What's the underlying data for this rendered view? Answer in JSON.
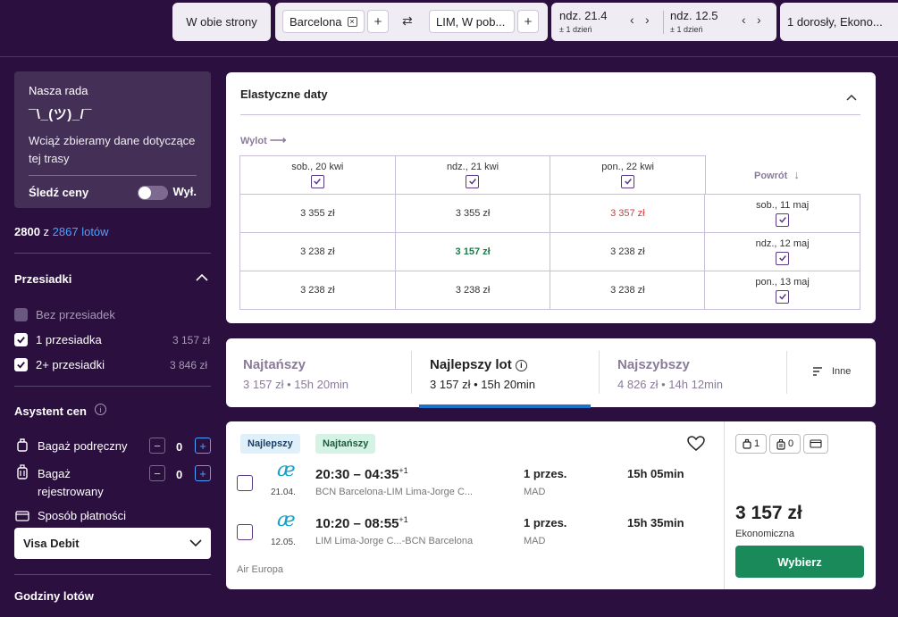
{
  "search": {
    "trip_type": "W obie strony",
    "origin": "Barcelona",
    "destination": "LIM, W pob...",
    "depart": {
      "date": "ndz. 21.4",
      "flex": "± 1 dzień"
    },
    "return": {
      "date": "ndz. 12.5",
      "flex": "± 1 dzień"
    },
    "passengers": "1 dorosły, Ekono..."
  },
  "advice": {
    "title": "Nasza rada",
    "shrug": "¯\\_(ツ)_/¯",
    "text": "Wciąż zbieramy dane dotyczące tej trasy",
    "track_label": "Śledź ceny",
    "toggle_state": "Wył."
  },
  "results_count": {
    "shown": "2800",
    "of": "z",
    "total": "2867 lotów"
  },
  "stops": {
    "title": "Przesiadki",
    "options": [
      {
        "label": "Bez przesiadek",
        "price": "",
        "checked": false,
        "disabled": true
      },
      {
        "label": "1 przesiadka",
        "price": "3 157 zł",
        "checked": true,
        "disabled": false
      },
      {
        "label": "2+ przesiadki",
        "price": "3 846 zł",
        "checked": true,
        "disabled": false
      }
    ]
  },
  "price_assistant": {
    "title": "Asystent cen",
    "carry_on": {
      "label": "Bagaż podręczny",
      "count": "0"
    },
    "checked_bag": {
      "label": "Bagaż rejestrowany",
      "count": "0"
    },
    "payment_label": "Sposób płatności",
    "payment_value": "Visa Debit"
  },
  "flight_hours_title": "Godziny lotów",
  "flex_dates": {
    "title": "Elastyczne daty",
    "depart_label": "Wylot",
    "return_label": "Powrót",
    "depart_dates": [
      "sob., 20 kwi",
      "ndz., 21 kwi",
      "pon., 22 kwi"
    ],
    "return_dates": [
      "sob., 11 maj",
      "ndz., 12 maj",
      "pon., 13 maj"
    ],
    "prices": [
      [
        "3 355 zł",
        "3 355 zł",
        "3 357 zł"
      ],
      [
        "3 238 zł",
        "3 157 zł",
        "3 238 zł"
      ],
      [
        "3 238 zł",
        "3 238 zł",
        "3 238 zł"
      ]
    ]
  },
  "sort_tabs": [
    {
      "label": "Najtańszy",
      "sub": "3 157 zł • 15h 20min",
      "active": false
    },
    {
      "label": "Najlepszy lot",
      "sub": "3 157 zł • 15h 20min",
      "active": true
    },
    {
      "label": "Najszybszy",
      "sub": "4 826 zł • 14h 12min",
      "active": false
    }
  ],
  "sort_other": "Inne",
  "flight": {
    "badges": [
      "Najlepszy",
      "Najtańszy"
    ],
    "legs": [
      {
        "time": "20:30 – 04:35",
        "plus": "+1",
        "date": "21.04.",
        "route": "BCN Barcelona-LIM Lima-Jorge C...",
        "stops": "1 przes.",
        "via": "MAD",
        "duration": "15h 05min"
      },
      {
        "time": "10:20 – 08:55",
        "plus": "+1",
        "date": "12.05.",
        "route": "LIM Lima-Jorge C...-BCN Barcelona",
        "stops": "1 przes.",
        "via": "MAD",
        "duration": "15h 35min"
      }
    ],
    "airline": "Air Europa",
    "bag_counts": [
      "1",
      "0"
    ],
    "price": "3 157 zł",
    "cabin": "Ekonomiczna",
    "select_label": "Wybierz"
  }
}
